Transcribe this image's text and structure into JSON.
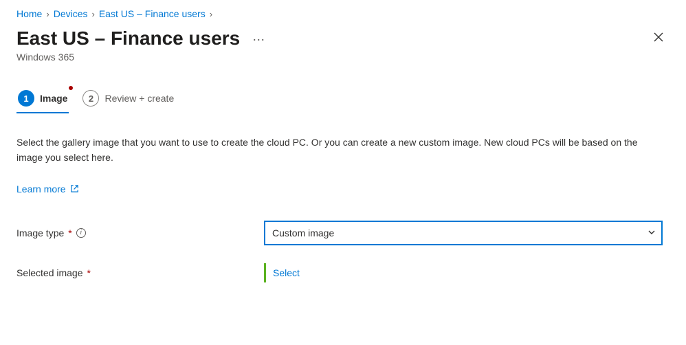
{
  "breadcrumb": {
    "items": [
      "Home",
      "Devices",
      "East US – Finance users"
    ]
  },
  "header": {
    "title": "East US – Finance users",
    "subtitle": "Windows 365"
  },
  "tabs": {
    "step1_num": "1",
    "step1_label": "Image",
    "step2_num": "2",
    "step2_label": "Review + create"
  },
  "body": {
    "description": "Select the gallery image that you want to use to create the cloud PC. Or you can create a new custom image. New cloud PCs will be based on the image you select here.",
    "learn_more": "Learn more"
  },
  "form": {
    "image_type_label": "Image type",
    "image_type_value": "Custom image",
    "selected_image_label": "Selected image",
    "select_action": "Select",
    "required_marker": "*",
    "info_glyph": "i"
  }
}
